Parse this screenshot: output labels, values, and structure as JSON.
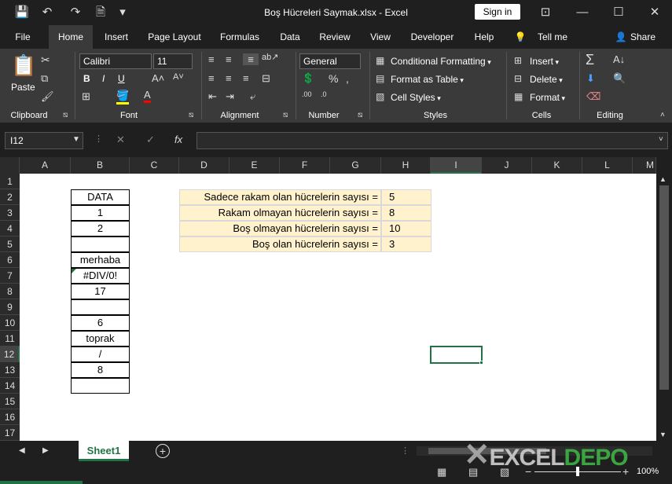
{
  "window": {
    "title": "Boş Hücreleri Saymak.xlsx  -  Excel",
    "signin_label": "Sign in"
  },
  "tabs": [
    "File",
    "Home",
    "Insert",
    "Page Layout",
    "Formulas",
    "Data",
    "Review",
    "View",
    "Developer",
    "Help",
    "Tell me",
    "Share"
  ],
  "ribbon": {
    "clipboard": {
      "paste": "Paste",
      "label": "Clipboard"
    },
    "font": {
      "name": "Calibri",
      "size": "11",
      "bold": "B",
      "italic": "I",
      "underline": "U",
      "label": "Font"
    },
    "alignment": {
      "label": "Alignment"
    },
    "number": {
      "format": "General",
      "label": "Number"
    },
    "styles": {
      "conditional": "Conditional Formatting",
      "table": "Format as Table",
      "cell_styles": "Cell Styles",
      "label": "Styles"
    },
    "cells": {
      "insert": "Insert",
      "delete": "Delete",
      "format": "Format",
      "label": "Cells"
    },
    "editing": {
      "label": "Editing"
    }
  },
  "formula_bar": {
    "name_box": "I12",
    "fx": "fx",
    "cancel": "✕",
    "enter": "✓"
  },
  "grid": {
    "columns": [
      "A",
      "B",
      "C",
      "D",
      "E",
      "F",
      "G",
      "H",
      "I",
      "J",
      "K",
      "L",
      "M"
    ],
    "rows": [
      "1",
      "2",
      "3",
      "4",
      "5",
      "6",
      "7",
      "8",
      "9",
      "10",
      "11",
      "12",
      "13",
      "14",
      "15",
      "16",
      "17"
    ],
    "data_column": [
      "DATA",
      "1",
      "2",
      "",
      "merhaba",
      "#DIV/0!",
      "17",
      "",
      "6",
      "toprak",
      "/",
      "8",
      ""
    ],
    "summary": [
      {
        "label": "Sadece rakam olan hücrelerin sayısı =",
        "value": "5"
      },
      {
        "label": "Rakam olmayan hücrelerin sayısı =",
        "value": "8"
      },
      {
        "label": "Boş olmayan hücrelerin sayısı =",
        "value": "10"
      },
      {
        "label": "Boş olan hücrelerin sayısı =",
        "value": "3"
      }
    ]
  },
  "sheet_tabs": {
    "active": "Sheet1"
  },
  "status": {
    "zoom": "100%"
  },
  "watermark": "EXCELDEPO",
  "colors": {
    "accent": "#217346",
    "summary_fill": "#fff2cc",
    "selection": "#217346"
  }
}
